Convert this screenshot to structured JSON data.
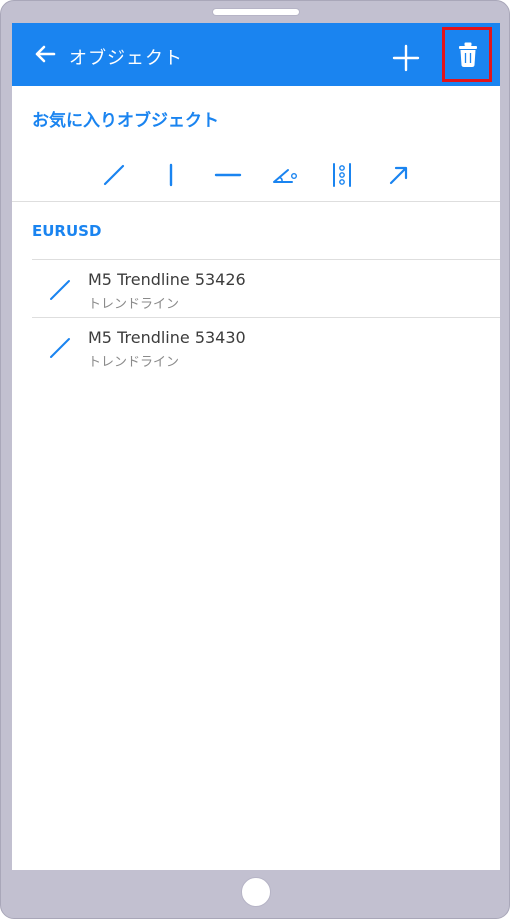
{
  "appbar": {
    "title": "オブジェクト",
    "back_icon": "arrow-left-icon",
    "add_icon": "plus-icon",
    "delete_icon": "trash-icon",
    "bar_color": "#1a84f0",
    "highlight_color": "#e2141a"
  },
  "favorites": {
    "title": "お気に入りオブジェクト",
    "tools": [
      "trendline-icon",
      "vertical-line-icon",
      "horizontal-line-icon",
      "trend-angle-icon",
      "fibonacci-icon",
      "arrow-icon"
    ]
  },
  "symbol": "EURUSD",
  "objects": [
    {
      "name": "M5 Trendline 53426",
      "type": "トレンドライン"
    },
    {
      "name": "M5 Trendline 53430",
      "type": "トレンドライン"
    }
  ]
}
